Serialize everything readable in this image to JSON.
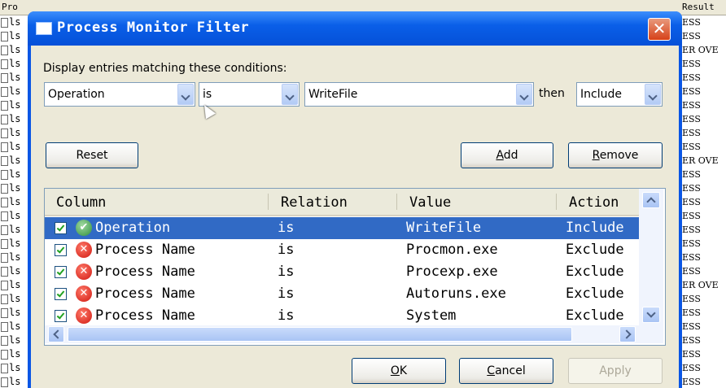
{
  "background": {
    "header": {
      "col1": "Pro",
      "col2": "Result"
    },
    "left_rows": [
      "ls",
      "ls",
      "ls",
      "ls",
      "ls",
      "ls",
      "ls",
      "ls",
      "ls",
      "ls",
      "ls",
      "ls",
      "ls",
      "ls",
      "ls",
      "ls",
      "ls",
      "ls",
      "ls",
      "ls",
      "ls",
      "ls",
      "ls",
      "ls",
      "ls",
      "ls",
      "ls"
    ],
    "right_rows": [
      "ESS",
      "ESS",
      "ER OVE",
      "ESS",
      "ESS",
      "ESS",
      "ESS",
      "ESS",
      "ESS",
      "ESS",
      "ER OVE",
      "ESS",
      "ESS",
      "ESS",
      "ESS",
      "ESS",
      "ESS",
      "ESS",
      "ESS",
      "ER OVE",
      "ESS",
      "ESS",
      "ESS",
      "ESS",
      "ESS",
      "ESS",
      "ESS"
    ]
  },
  "dialog": {
    "title": "Process Monitor Filter",
    "prompt": "Display entries matching these conditions:",
    "column_combo": "Operation",
    "relation_combo": "is",
    "value_combo": "WriteFile",
    "then_label": "then",
    "action_combo": "Include",
    "buttons": {
      "reset": "Reset",
      "add": "Add",
      "remove": "Remove",
      "ok": "OK",
      "cancel": "Cancel",
      "apply": "Apply"
    },
    "list": {
      "headers": [
        "Column",
        "Relation",
        "Value",
        "Action"
      ],
      "rows": [
        {
          "column": "Operation",
          "relation": "is",
          "value": "WriteFile",
          "action": "Include",
          "type": "include",
          "selected": true
        },
        {
          "column": "Process Name",
          "relation": "is",
          "value": "Procmon.exe",
          "action": "Exclude",
          "type": "exclude",
          "selected": false
        },
        {
          "column": "Process Name",
          "relation": "is",
          "value": "Procexp.exe",
          "action": "Exclude",
          "type": "exclude",
          "selected": false
        },
        {
          "column": "Process Name",
          "relation": "is",
          "value": "Autoruns.exe",
          "action": "Exclude",
          "type": "exclude",
          "selected": false
        },
        {
          "column": "Process Name",
          "relation": "is",
          "value": "System",
          "action": "Exclude",
          "type": "exclude",
          "selected": false
        }
      ]
    }
  }
}
